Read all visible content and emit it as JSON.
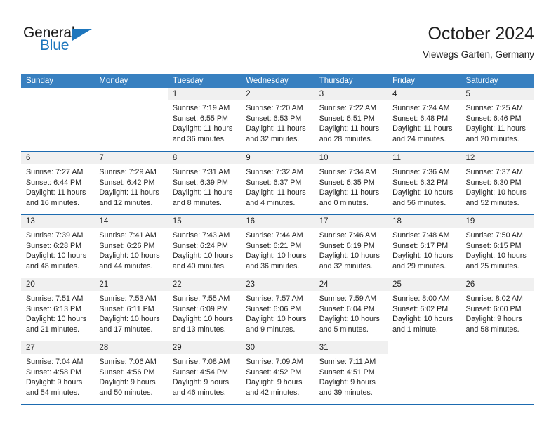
{
  "brand": {
    "name_part1": "General",
    "name_part2": "Blue",
    "logo_icon": "triangle-icon",
    "accent_color": "#1d76bd"
  },
  "header": {
    "title": "October 2024",
    "subtitle": "Viewegs Garten, Germany"
  },
  "calendar": {
    "header_bg": "#3880c0",
    "row_rule_color": "#1d6bb0",
    "daynum_band_bg": "#f0f0f0",
    "weekdays": [
      "Sunday",
      "Monday",
      "Tuesday",
      "Wednesday",
      "Thursday",
      "Friday",
      "Saturday"
    ],
    "weeks": [
      [
        {
          "day": "",
          "lines": []
        },
        {
          "day": "",
          "lines": []
        },
        {
          "day": "1",
          "lines": [
            "Sunrise: 7:19 AM",
            "Sunset: 6:55 PM",
            "Daylight: 11 hours",
            "and 36 minutes."
          ]
        },
        {
          "day": "2",
          "lines": [
            "Sunrise: 7:20 AM",
            "Sunset: 6:53 PM",
            "Daylight: 11 hours",
            "and 32 minutes."
          ]
        },
        {
          "day": "3",
          "lines": [
            "Sunrise: 7:22 AM",
            "Sunset: 6:51 PM",
            "Daylight: 11 hours",
            "and 28 minutes."
          ]
        },
        {
          "day": "4",
          "lines": [
            "Sunrise: 7:24 AM",
            "Sunset: 6:48 PM",
            "Daylight: 11 hours",
            "and 24 minutes."
          ]
        },
        {
          "day": "5",
          "lines": [
            "Sunrise: 7:25 AM",
            "Sunset: 6:46 PM",
            "Daylight: 11 hours",
            "and 20 minutes."
          ]
        }
      ],
      [
        {
          "day": "6",
          "lines": [
            "Sunrise: 7:27 AM",
            "Sunset: 6:44 PM",
            "Daylight: 11 hours",
            "and 16 minutes."
          ]
        },
        {
          "day": "7",
          "lines": [
            "Sunrise: 7:29 AM",
            "Sunset: 6:42 PM",
            "Daylight: 11 hours",
            "and 12 minutes."
          ]
        },
        {
          "day": "8",
          "lines": [
            "Sunrise: 7:31 AM",
            "Sunset: 6:39 PM",
            "Daylight: 11 hours",
            "and 8 minutes."
          ]
        },
        {
          "day": "9",
          "lines": [
            "Sunrise: 7:32 AM",
            "Sunset: 6:37 PM",
            "Daylight: 11 hours",
            "and 4 minutes."
          ]
        },
        {
          "day": "10",
          "lines": [
            "Sunrise: 7:34 AM",
            "Sunset: 6:35 PM",
            "Daylight: 11 hours",
            "and 0 minutes."
          ]
        },
        {
          "day": "11",
          "lines": [
            "Sunrise: 7:36 AM",
            "Sunset: 6:32 PM",
            "Daylight: 10 hours",
            "and 56 minutes."
          ]
        },
        {
          "day": "12",
          "lines": [
            "Sunrise: 7:37 AM",
            "Sunset: 6:30 PM",
            "Daylight: 10 hours",
            "and 52 minutes."
          ]
        }
      ],
      [
        {
          "day": "13",
          "lines": [
            "Sunrise: 7:39 AM",
            "Sunset: 6:28 PM",
            "Daylight: 10 hours",
            "and 48 minutes."
          ]
        },
        {
          "day": "14",
          "lines": [
            "Sunrise: 7:41 AM",
            "Sunset: 6:26 PM",
            "Daylight: 10 hours",
            "and 44 minutes."
          ]
        },
        {
          "day": "15",
          "lines": [
            "Sunrise: 7:43 AM",
            "Sunset: 6:24 PM",
            "Daylight: 10 hours",
            "and 40 minutes."
          ]
        },
        {
          "day": "16",
          "lines": [
            "Sunrise: 7:44 AM",
            "Sunset: 6:21 PM",
            "Daylight: 10 hours",
            "and 36 minutes."
          ]
        },
        {
          "day": "17",
          "lines": [
            "Sunrise: 7:46 AM",
            "Sunset: 6:19 PM",
            "Daylight: 10 hours",
            "and 32 minutes."
          ]
        },
        {
          "day": "18",
          "lines": [
            "Sunrise: 7:48 AM",
            "Sunset: 6:17 PM",
            "Daylight: 10 hours",
            "and 29 minutes."
          ]
        },
        {
          "day": "19",
          "lines": [
            "Sunrise: 7:50 AM",
            "Sunset: 6:15 PM",
            "Daylight: 10 hours",
            "and 25 minutes."
          ]
        }
      ],
      [
        {
          "day": "20",
          "lines": [
            "Sunrise: 7:51 AM",
            "Sunset: 6:13 PM",
            "Daylight: 10 hours",
            "and 21 minutes."
          ]
        },
        {
          "day": "21",
          "lines": [
            "Sunrise: 7:53 AM",
            "Sunset: 6:11 PM",
            "Daylight: 10 hours",
            "and 17 minutes."
          ]
        },
        {
          "day": "22",
          "lines": [
            "Sunrise: 7:55 AM",
            "Sunset: 6:09 PM",
            "Daylight: 10 hours",
            "and 13 minutes."
          ]
        },
        {
          "day": "23",
          "lines": [
            "Sunrise: 7:57 AM",
            "Sunset: 6:06 PM",
            "Daylight: 10 hours",
            "and 9 minutes."
          ]
        },
        {
          "day": "24",
          "lines": [
            "Sunrise: 7:59 AM",
            "Sunset: 6:04 PM",
            "Daylight: 10 hours",
            "and 5 minutes."
          ]
        },
        {
          "day": "25",
          "lines": [
            "Sunrise: 8:00 AM",
            "Sunset: 6:02 PM",
            "Daylight: 10 hours",
            "and 1 minute."
          ]
        },
        {
          "day": "26",
          "lines": [
            "Sunrise: 8:02 AM",
            "Sunset: 6:00 PM",
            "Daylight: 9 hours",
            "and 58 minutes."
          ]
        }
      ],
      [
        {
          "day": "27",
          "lines": [
            "Sunrise: 7:04 AM",
            "Sunset: 4:58 PM",
            "Daylight: 9 hours",
            "and 54 minutes."
          ]
        },
        {
          "day": "28",
          "lines": [
            "Sunrise: 7:06 AM",
            "Sunset: 4:56 PM",
            "Daylight: 9 hours",
            "and 50 minutes."
          ]
        },
        {
          "day": "29",
          "lines": [
            "Sunrise: 7:08 AM",
            "Sunset: 4:54 PM",
            "Daylight: 9 hours",
            "and 46 minutes."
          ]
        },
        {
          "day": "30",
          "lines": [
            "Sunrise: 7:09 AM",
            "Sunset: 4:52 PM",
            "Daylight: 9 hours",
            "and 42 minutes."
          ]
        },
        {
          "day": "31",
          "lines": [
            "Sunrise: 7:11 AM",
            "Sunset: 4:51 PM",
            "Daylight: 9 hours",
            "and 39 minutes."
          ]
        },
        {
          "day": "",
          "lines": []
        },
        {
          "day": "",
          "lines": []
        }
      ]
    ]
  }
}
